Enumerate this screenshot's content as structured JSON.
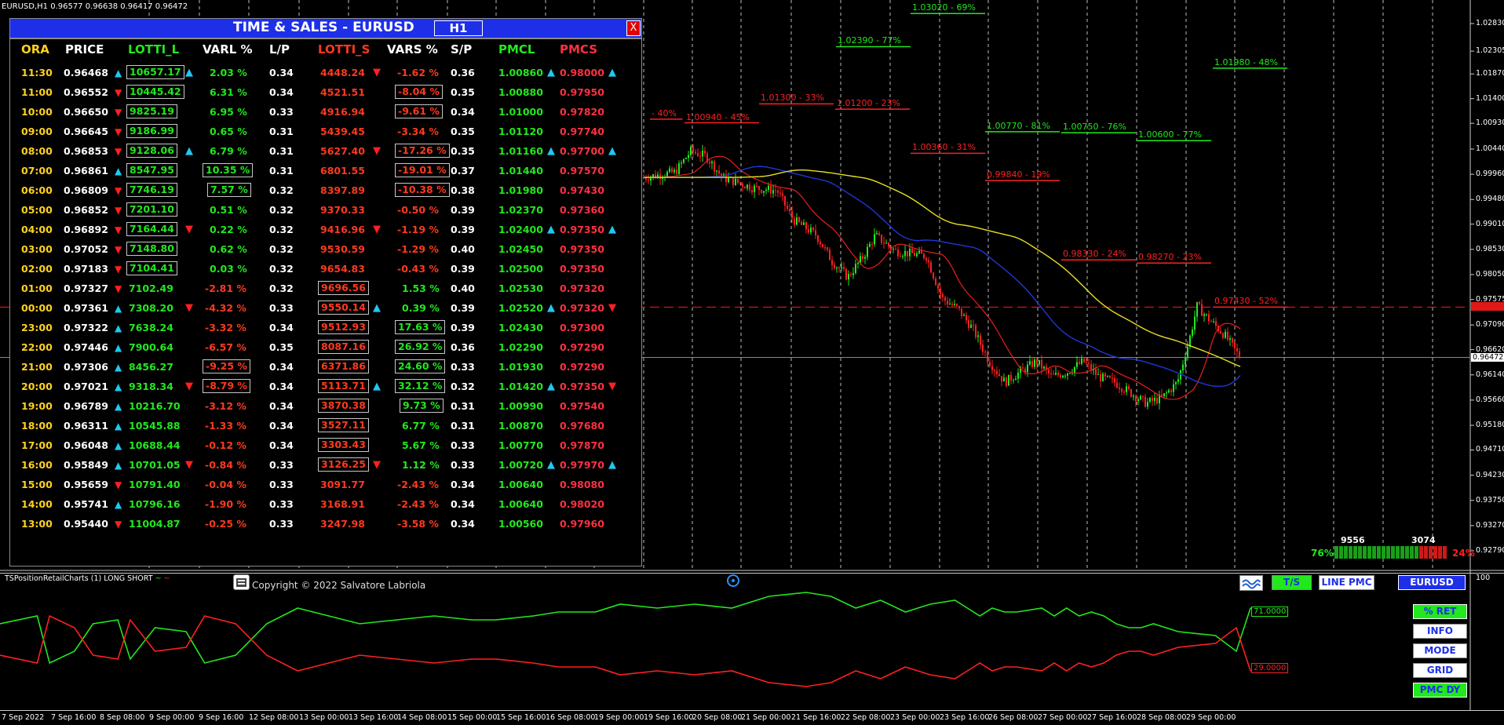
{
  "symbol_header": "EURUSD,H1  0.96577 0.96638 0.96417 0.96472",
  "panel": {
    "title": "TIME & SALES  - EURUSD",
    "timeframe": "H1",
    "close_glyph": "X",
    "headers": [
      "ORA",
      "PRICE",
      "LOTTI_L",
      "VARL %",
      "L/P",
      "LOTTI_S",
      "VARS %",
      "S/P",
      "PMCL",
      "PMCS"
    ],
    "rows": [
      {
        "ora": "11:30",
        "price": "0.96468",
        "pa": "up",
        "lotti_l": "10657.17",
        "lb": true,
        "la": "up",
        "varl": "2.03 %",
        "vlb": false,
        "vlc": "gr",
        "lp": "0.34",
        "lotti_s": "4448.24",
        "sb": false,
        "sa": "dn",
        "vars": "-1.62 %",
        "vsb": false,
        "vsc": "rd",
        "sp": "0.36",
        "pmcl": "1.00860",
        "pla": "up",
        "pmcs": "0.98000",
        "psa": "up"
      },
      {
        "ora": "11:00",
        "price": "0.96552",
        "pa": "dn",
        "lotti_l": "10445.42",
        "lb": true,
        "la": "",
        "varl": "6.31 %",
        "vlb": false,
        "vlc": "gr",
        "lp": "0.34",
        "lotti_s": "4521.51",
        "sb": false,
        "sa": "",
        "vars": "-8.04 %",
        "vsb": true,
        "vsc": "rd",
        "sp": "0.35",
        "pmcl": "1.00880",
        "pla": "",
        "pmcs": "0.97950",
        "psa": ""
      },
      {
        "ora": "10:00",
        "price": "0.96650",
        "pa": "dn",
        "lotti_l": "9825.19",
        "lb": true,
        "la": "",
        "varl": "6.95 %",
        "vlb": false,
        "vlc": "gr",
        "lp": "0.33",
        "lotti_s": "4916.94",
        "sb": false,
        "sa": "",
        "vars": "-9.61 %",
        "vsb": true,
        "vsc": "rd",
        "sp": "0.34",
        "pmcl": "1.01000",
        "pla": "",
        "pmcs": "0.97820",
        "psa": ""
      },
      {
        "ora": "09:00",
        "price": "0.96645",
        "pa": "dn",
        "lotti_l": "9186.99",
        "lb": true,
        "la": "",
        "varl": "0.65 %",
        "vlb": false,
        "vlc": "gr",
        "lp": "0.31",
        "lotti_s": "5439.45",
        "sb": false,
        "sa": "",
        "vars": "-3.34 %",
        "vsb": false,
        "vsc": "rd",
        "sp": "0.35",
        "pmcl": "1.01120",
        "pla": "",
        "pmcs": "0.97740",
        "psa": ""
      },
      {
        "ora": "08:00",
        "price": "0.96853",
        "pa": "dn",
        "lotti_l": "9128.06",
        "lb": true,
        "la": "up",
        "varl": "6.79 %",
        "vlb": false,
        "vlc": "gr",
        "lp": "0.31",
        "lotti_s": "5627.40",
        "sb": false,
        "sa": "dn",
        "vars": "-17.26 %",
        "vsb": true,
        "vsc": "rd",
        "sp": "0.35",
        "pmcl": "1.01160",
        "pla": "up",
        "pmcs": "0.97700",
        "psa": "up"
      },
      {
        "ora": "07:00",
        "price": "0.96861",
        "pa": "up",
        "lotti_l": "8547.95",
        "lb": true,
        "la": "",
        "varl": "10.35 %",
        "vlb": true,
        "vlc": "gr",
        "lp": "0.31",
        "lotti_s": "6801.55",
        "sb": false,
        "sa": "",
        "vars": "-19.01 %",
        "vsb": true,
        "vsc": "rd",
        "sp": "0.37",
        "pmcl": "1.01440",
        "pla": "",
        "pmcs": "0.97570",
        "psa": ""
      },
      {
        "ora": "06:00",
        "price": "0.96809",
        "pa": "dn",
        "lotti_l": "7746.19",
        "lb": true,
        "la": "",
        "varl": "7.57 %",
        "vlb": true,
        "vlc": "gr",
        "lp": "0.32",
        "lotti_s": "8397.89",
        "sb": false,
        "sa": "",
        "vars": "-10.38 %",
        "vsb": true,
        "vsc": "rd",
        "sp": "0.38",
        "pmcl": "1.01980",
        "pla": "",
        "pmcs": "0.97430",
        "psa": ""
      },
      {
        "ora": "05:00",
        "price": "0.96852",
        "pa": "dn",
        "lotti_l": "7201.10",
        "lb": true,
        "la": "",
        "varl": "0.51 %",
        "vlb": false,
        "vlc": "gr",
        "lp": "0.32",
        "lotti_s": "9370.33",
        "sb": false,
        "sa": "",
        "vars": "-0.50 %",
        "vsb": false,
        "vsc": "rd",
        "sp": "0.39",
        "pmcl": "1.02370",
        "pla": "",
        "pmcs": "0.97360",
        "psa": ""
      },
      {
        "ora": "04:00",
        "price": "0.96892",
        "pa": "dn",
        "lotti_l": "7164.44",
        "lb": true,
        "la": "dn",
        "varl": "0.22 %",
        "vlb": false,
        "vlc": "gr",
        "lp": "0.32",
        "lotti_s": "9416.96",
        "sb": false,
        "sa": "dn",
        "vars": "-1.19 %",
        "vsb": false,
        "vsc": "rd",
        "sp": "0.39",
        "pmcl": "1.02400",
        "pla": "up",
        "pmcs": "0.97350",
        "psa": "up"
      },
      {
        "ora": "03:00",
        "price": "0.97052",
        "pa": "dn",
        "lotti_l": "7148.80",
        "lb": true,
        "la": "",
        "varl": "0.62 %",
        "vlb": false,
        "vlc": "gr",
        "lp": "0.32",
        "lotti_s": "9530.59",
        "sb": false,
        "sa": "",
        "vars": "-1.29 %",
        "vsb": false,
        "vsc": "rd",
        "sp": "0.40",
        "pmcl": "1.02450",
        "pla": "",
        "pmcs": "0.97350",
        "psa": ""
      },
      {
        "ora": "02:00",
        "price": "0.97183",
        "pa": "dn",
        "lotti_l": "7104.41",
        "lb": true,
        "la": "",
        "varl": "0.03 %",
        "vlb": false,
        "vlc": "gr",
        "lp": "0.32",
        "lotti_s": "9654.83",
        "sb": false,
        "sa": "",
        "vars": "-0.43 %",
        "vsb": false,
        "vsc": "rd",
        "sp": "0.39",
        "pmcl": "1.02500",
        "pla": "",
        "pmcs": "0.97350",
        "psa": ""
      },
      {
        "ora": "01:00",
        "price": "0.97327",
        "pa": "dn",
        "lotti_l": "7102.49",
        "lb": false,
        "la": "",
        "varl": "-2.81 %",
        "vlb": false,
        "vlc": "rd",
        "lp": "0.32",
        "lotti_s": "9696.56",
        "sb": true,
        "sa": "",
        "vars": "1.53 %",
        "vsb": false,
        "vsc": "gr",
        "sp": "0.40",
        "pmcl": "1.02530",
        "pla": "",
        "pmcs": "0.97320",
        "psa": ""
      },
      {
        "ora": "00:00",
        "price": "0.97361",
        "pa": "up",
        "lotti_l": "7308.20",
        "lb": false,
        "la": "dn",
        "varl": "-4.32 %",
        "vlb": false,
        "vlc": "rd",
        "lp": "0.33",
        "lotti_s": "9550.14",
        "sb": true,
        "sa": "up",
        "vars": "0.39 %",
        "vsb": false,
        "vsc": "gr",
        "sp": "0.39",
        "pmcl": "1.02520",
        "pla": "up",
        "pmcs": "0.97320",
        "psa": "dn"
      },
      {
        "ora": "23:00",
        "price": "0.97322",
        "pa": "up",
        "lotti_l": "7638.24",
        "lb": false,
        "la": "",
        "varl": "-3.32 %",
        "vlb": false,
        "vlc": "rd",
        "lp": "0.34",
        "lotti_s": "9512.93",
        "sb": true,
        "sa": "",
        "vars": "17.63 %",
        "vsb": true,
        "vsc": "gr",
        "sp": "0.39",
        "pmcl": "1.02430",
        "pla": "",
        "pmcs": "0.97300",
        "psa": ""
      },
      {
        "ora": "22:00",
        "price": "0.97446",
        "pa": "up",
        "lotti_l": "7900.64",
        "lb": false,
        "la": "",
        "varl": "-6.57 %",
        "vlb": false,
        "vlc": "rd",
        "lp": "0.35",
        "lotti_s": "8087.16",
        "sb": true,
        "sa": "",
        "vars": "26.92 %",
        "vsb": true,
        "vsc": "gr",
        "sp": "0.36",
        "pmcl": "1.02290",
        "pla": "",
        "pmcs": "0.97290",
        "psa": ""
      },
      {
        "ora": "21:00",
        "price": "0.97306",
        "pa": "up",
        "lotti_l": "8456.27",
        "lb": false,
        "la": "",
        "varl": "-9.25 %",
        "vlb": true,
        "vlc": "rd",
        "lp": "0.34",
        "lotti_s": "6371.86",
        "sb": true,
        "sa": "",
        "vars": "24.60 %",
        "vsb": true,
        "vsc": "gr",
        "sp": "0.33",
        "pmcl": "1.01930",
        "pla": "",
        "pmcs": "0.97290",
        "psa": ""
      },
      {
        "ora": "20:00",
        "price": "0.97021",
        "pa": "up",
        "lotti_l": "9318.34",
        "lb": false,
        "la": "dn",
        "varl": "-8.79 %",
        "vlb": true,
        "vlc": "rd",
        "lp": "0.34",
        "lotti_s": "5113.71",
        "sb": true,
        "sa": "up",
        "vars": "32.12 %",
        "vsb": true,
        "vsc": "gr",
        "sp": "0.32",
        "pmcl": "1.01420",
        "pla": "up",
        "pmcs": "0.97350",
        "psa": "dn"
      },
      {
        "ora": "19:00",
        "price": "0.96789",
        "pa": "up",
        "lotti_l": "10216.70",
        "lb": false,
        "la": "",
        "varl": "-3.12 %",
        "vlb": false,
        "vlc": "rd",
        "lp": "0.34",
        "lotti_s": "3870.38",
        "sb": true,
        "sa": "",
        "vars": "9.73 %",
        "vsb": true,
        "vsc": "gr",
        "sp": "0.31",
        "pmcl": "1.00990",
        "pla": "",
        "pmcs": "0.97540",
        "psa": ""
      },
      {
        "ora": "18:00",
        "price": "0.96311",
        "pa": "up",
        "lotti_l": "10545.88",
        "lb": false,
        "la": "",
        "varl": "-1.33 %",
        "vlb": false,
        "vlc": "rd",
        "lp": "0.34",
        "lotti_s": "3527.11",
        "sb": true,
        "sa": "",
        "vars": "6.77 %",
        "vsb": false,
        "vsc": "gr",
        "sp": "0.31",
        "pmcl": "1.00870",
        "pla": "",
        "pmcs": "0.97680",
        "psa": ""
      },
      {
        "ora": "17:00",
        "price": "0.96048",
        "pa": "up",
        "lotti_l": "10688.44",
        "lb": false,
        "la": "",
        "varl": "-0.12 %",
        "vlb": false,
        "vlc": "rd",
        "lp": "0.34",
        "lotti_s": "3303.43",
        "sb": true,
        "sa": "",
        "vars": "5.67 %",
        "vsb": false,
        "vsc": "gr",
        "sp": "0.33",
        "pmcl": "1.00770",
        "pla": "",
        "pmcs": "0.97870",
        "psa": ""
      },
      {
        "ora": "16:00",
        "price": "0.95849",
        "pa": "up",
        "lotti_l": "10701.05",
        "lb": false,
        "la": "dn",
        "varl": "-0.84 %",
        "vlb": false,
        "vlc": "rd",
        "lp": "0.33",
        "lotti_s": "3126.25",
        "sb": true,
        "sa": "dn",
        "vars": "1.12 %",
        "vsb": false,
        "vsc": "gr",
        "sp": "0.33",
        "pmcl": "1.00720",
        "pla": "up",
        "pmcs": "0.97970",
        "psa": "up"
      },
      {
        "ora": "15:00",
        "price": "0.95659",
        "pa": "dn",
        "lotti_l": "10791.40",
        "lb": false,
        "la": "",
        "varl": "-0.04 %",
        "vlb": false,
        "vlc": "rd",
        "lp": "0.33",
        "lotti_s": "3091.77",
        "sb": false,
        "sa": "",
        "vars": "-2.43 %",
        "vsb": false,
        "vsc": "rd",
        "sp": "0.34",
        "pmcl": "1.00640",
        "pla": "",
        "pmcs": "0.98080",
        "psa": ""
      },
      {
        "ora": "14:00",
        "price": "0.95741",
        "pa": "up",
        "lotti_l": "10796.16",
        "lb": false,
        "la": "",
        "varl": "-1.90 %",
        "vlb": false,
        "vlc": "rd",
        "lp": "0.33",
        "lotti_s": "3168.91",
        "sb": false,
        "sa": "",
        "vars": "-2.43 %",
        "vsb": false,
        "vsc": "rd",
        "sp": "0.34",
        "pmcl": "1.00640",
        "pla": "",
        "pmcs": "0.98020",
        "psa": ""
      },
      {
        "ora": "13:00",
        "price": "0.95440",
        "pa": "dn",
        "lotti_l": "11004.87",
        "lb": false,
        "la": "",
        "varl": "-0.25 %",
        "vlb": false,
        "vlc": "rd",
        "lp": "0.33",
        "lotti_s": "3247.98",
        "sb": false,
        "sa": "",
        "vars": "-3.58 %",
        "vsb": false,
        "vsc": "rd",
        "sp": "0.34",
        "pmcl": "1.00560",
        "pla": "",
        "pmcs": "0.97960",
        "psa": ""
      }
    ]
  },
  "price_axis": [
    "1.02830",
    "1.02305",
    "1.01870",
    "1.01400",
    "1.00930",
    "1.00440",
    "0.99960",
    "0.99480",
    "0.99010",
    "0.98530",
    "0.98050",
    "0.97575",
    "0.97090",
    "0.96620",
    "0.96140",
    "0.95660",
    "0.95180",
    "0.94710",
    "0.94230",
    "0.93750",
    "0.93270",
    "0.92790"
  ],
  "price_markers": {
    "line_red": "0.97430",
    "current": "0.96472"
  },
  "levels_green": [
    {
      "text": "1.03020 - 69%",
      "price": 1.0302
    },
    {
      "text": "1.02390 - 77%",
      "price": 1.0239
    },
    {
      "text": "1.01980 - 48%",
      "price": 1.0198
    },
    {
      "text": "1.00770 - 81%",
      "price": 1.0077
    },
    {
      "text": "1.00750 - 76%",
      "price": 1.0075
    },
    {
      "text": "1.00600 - 77%",
      "price": 1.006
    }
  ],
  "levels_red": [
    {
      "text": "- 40%",
      "price": 1.0101
    },
    {
      "text": "1.00940 - 45%",
      "price": 1.0094
    },
    {
      "text": "1.01300 - 33%",
      "price": 1.013
    },
    {
      "text": "1.01200 - 23%",
      "price": 1.012
    },
    {
      "text": "1.00360 - 31%",
      "price": 1.0036
    },
    {
      "text": "0.99840 - 19%",
      "price": 0.9984
    },
    {
      "text": "0.98330 - 24%",
      "price": 0.9833
    },
    {
      "text": "0.98270 - 23%",
      "price": 0.9827
    },
    {
      "text": "0.97430 - 52%",
      "price": 0.9743
    }
  ],
  "sentiment": {
    "long_count": "9556",
    "short_count": "3074",
    "long_pct_label": "76%",
    "short_pct_label": "24%",
    "long_fraction": 0.76
  },
  "subwindow": {
    "label": "TSPositionRetailCharts (1) LONG SHORT",
    "copyright": "Copyright © 2022 Salvatore Labriola",
    "scale_top": "100",
    "green_value": "71.0000",
    "red_value": "29.0000"
  },
  "buttons": {
    "ts": "T/S",
    "line_pmc": "LINE PMC",
    "symbol": "EURUSD",
    "ret": "% RET",
    "info": "INFO",
    "mode": "MODE",
    "grid": "GRID",
    "pmc_dy": "PMC DY"
  },
  "time_axis": [
    "7 Sep 2022",
    "7 Sep 16:00",
    "8 Sep 08:00",
    "9 Sep 00:00",
    "9 Sep 16:00",
    "12 Sep 08:00",
    "13 Sep 00:00",
    "13 Sep 16:00",
    "14 Sep 08:00",
    "15 Sep 00:00",
    "15 Sep 16:00",
    "16 Sep 08:00",
    "19 Sep 00:00",
    "19 Sep 16:00",
    "20 Sep 08:00",
    "21 Sep 00:00",
    "21 Sep 16:00",
    "22 Sep 08:00",
    "23 Sep 00:00",
    "23 Sep 16:00",
    "26 Sep 08:00",
    "27 Sep 00:00",
    "27 Sep 16:00",
    "28 Sep 08:00",
    "29 Sep 00:00"
  ],
  "colors": {
    "bull": "#22e81e",
    "bear": "#ff2020",
    "ma_fast": "#e8201e",
    "ma_mid": "#2036d8",
    "ma_slow": "#e8e020",
    "panel_title": "#1e2fe8"
  }
}
